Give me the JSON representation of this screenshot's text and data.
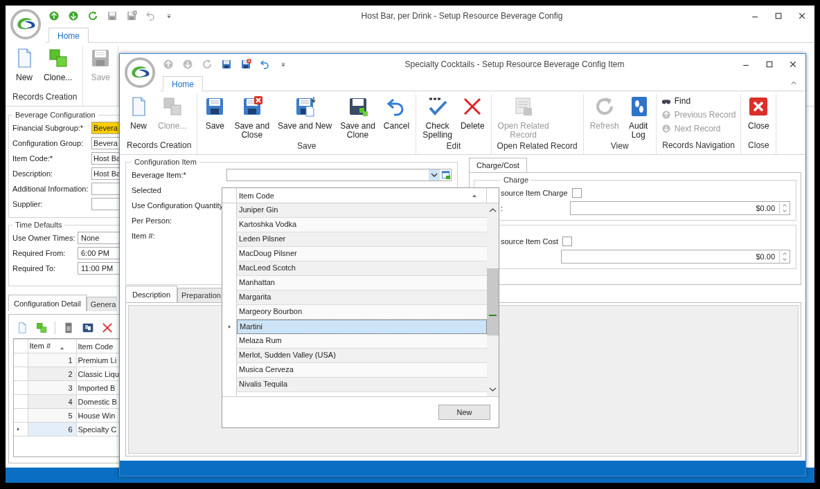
{
  "outer_window": {
    "quick_access": [
      {
        "disabled": false
      },
      {
        "disabled": false
      },
      {
        "disabled": false
      },
      {
        "disabled": true
      },
      {
        "disabled": true
      },
      {
        "disabled": true
      }
    ],
    "title": "Host Bar, per Drink - Setup Resource Beverage Config",
    "tabs": [
      {
        "label": "Home",
        "selected": true
      }
    ],
    "ribbon": {
      "groups": [
        {
          "label": "Records Creation",
          "kind": "large",
          "buttons": [
            {
              "label": "New",
              "disabled": false
            },
            {
              "label": "Clone...",
              "disabled": false
            }
          ]
        },
        {
          "kind": "large",
          "buttons": [
            {
              "label": "Save",
              "disabled": true
            }
          ]
        }
      ]
    },
    "beverage_configuration": {
      "title": "Beverage Configuration",
      "fields": [
        {
          "label": "Financial Subgroup:*",
          "value": "Bevera",
          "highlighted": true
        },
        {
          "label": "Configuration Group:",
          "value": "Bevera",
          "highlighted": false
        },
        {
          "label": "Item Code:*",
          "value": "Host Ba",
          "highlighted": false
        },
        {
          "label": "Description:",
          "value": "Host Ba",
          "highlighted": false
        },
        {
          "label": "Additional Information:",
          "highlighted": false
        },
        {
          "label": "Supplier:",
          "highlighted": false
        }
      ]
    },
    "time_defaults": {
      "title": "Time Defaults",
      "fields": [
        {
          "label": "Use Owner Times:",
          "value": "None"
        },
        {
          "label": "Required From:",
          "value": "6:00 PM"
        },
        {
          "label": "Required To:",
          "value": "11:00 PM"
        }
      ]
    },
    "detail_tabs": [
      {
        "label": "Configuration Detail",
        "selected": true
      },
      {
        "label": "Genera",
        "selected": false
      }
    ],
    "grid": {
      "columns": [
        {
          "label": "Item #",
          "sorted": true
        },
        {
          "label": "Item Code",
          "sorted": false
        }
      ],
      "rows": [
        {
          "item_no": "1",
          "item_code": "Premium Li",
          "selected": false
        },
        {
          "item_no": "2",
          "item_code": "Classic Liqu",
          "selected": false
        },
        {
          "item_no": "3",
          "item_code": "Imported B",
          "selected": false
        },
        {
          "item_no": "4",
          "item_code": "Domestic B",
          "selected": false
        },
        {
          "item_no": "5",
          "item_code": "House Win",
          "selected": false
        },
        {
          "item_no": "6",
          "item_code": "Specialty C",
          "selected": true
        }
      ]
    }
  },
  "inner_window": {
    "quick_access": [
      {
        "disabled": true
      },
      {
        "disabled": true
      },
      {
        "disabled": true
      },
      {
        "disabled": false
      },
      {
        "disabled": false
      },
      {
        "disabled": false
      }
    ],
    "title": "Specialty Cocktails - Setup Resource Beverage Config Item",
    "tabs": [
      {
        "label": "Home",
        "selected": true
      }
    ],
    "ribbon": {
      "groups": [
        {
          "label": "Records Creation",
          "kind": "large",
          "buttons": [
            {
              "label": "New",
              "disabled": false
            },
            {
              "label": "Clone...",
              "disabled": true
            }
          ]
        },
        {
          "label": "Save",
          "kind": "large",
          "buttons": [
            {
              "label": "Save",
              "disabled": false
            },
            {
              "label": "Save and\nClose",
              "disabled": false
            },
            {
              "label": "Save and New",
              "disabled": false
            },
            {
              "label": "Save and\nClone",
              "disabled": false
            },
            {
              "label": "Cancel",
              "disabled": false
            }
          ]
        },
        {
          "label": "Edit",
          "kind": "large",
          "buttons": [
            {
              "label": "Check\nSpelling",
              "disabled": false
            },
            {
              "label": "Delete",
              "disabled": false
            }
          ]
        },
        {
          "label": "Open Related Record",
          "kind": "large",
          "buttons": [
            {
              "label": "Open Related\nRecord",
              "disabled": true
            }
          ]
        },
        {
          "label": "View",
          "kind": "large",
          "buttons": [
            {
              "label": "Refresh",
              "disabled": true
            },
            {
              "label": "Audit\nLog",
              "disabled": false
            }
          ]
        },
        {
          "label": "Records Navigation",
          "kind": "small",
          "buttons": [
            {
              "label": "Find",
              "disabled": false
            },
            {
              "label": "Previous Record",
              "disabled": true
            },
            {
              "label": "Next Record",
              "disabled": true
            }
          ]
        },
        {
          "label": "Close",
          "kind": "large",
          "buttons": [
            {
              "label": "Close",
              "disabled": false
            }
          ]
        }
      ]
    },
    "configuration_item": {
      "title": "Configuration Item",
      "fields": [
        {
          "label": "Beverage Item:*",
          "kind": "combo"
        },
        {
          "label": "Selected",
          "kind": "label"
        },
        {
          "label": "Use Configuration Quantity",
          "kind": "label"
        },
        {
          "label": "Per Person:",
          "kind": "label"
        },
        {
          "label": "Item #:",
          "kind": "label"
        }
      ]
    },
    "charge_cost": {
      "tabs": [
        {
          "label": "Charge/Cost",
          "selected": true
        }
      ],
      "charge": {
        "title": "Charge",
        "checkbox_label": "source Item Charge",
        "checked": false,
        "amount_label": ":",
        "amount": "$0.00"
      },
      "cost": {
        "checkbox_label": "source Item Cost",
        "checked": false,
        "amount": "$0.00"
      }
    },
    "bottom_tabs": [
      {
        "label": "Description",
        "selected": true
      },
      {
        "label": "Preparation",
        "selected": false
      }
    ],
    "dropdown": {
      "columns": [
        {
          "label": "Item Code",
          "sorted": true
        }
      ],
      "rows": [
        {
          "label": "Juniper Gin",
          "selected": false
        },
        {
          "label": "Kartoshka Vodka",
          "selected": false
        },
        {
          "label": "Leden Pilsner",
          "selected": false
        },
        {
          "label": "MacDoug Pilsner",
          "selected": false
        },
        {
          "label": "MacLeod Scotch",
          "selected": false
        },
        {
          "label": "Manhattan",
          "selected": false
        },
        {
          "label": "Margarita",
          "selected": false
        },
        {
          "label": "Margeory Bourbon",
          "selected": false
        },
        {
          "label": "Martini",
          "selected": true
        },
        {
          "label": "Melaza Rum",
          "selected": false
        },
        {
          "label": "Merlot, Sudden Valley (USA)",
          "selected": false
        },
        {
          "label": "Musica Cerveza",
          "selected": false
        },
        {
          "label": "Nivalis Tequila",
          "selected": false
        }
      ],
      "button": "New"
    }
  }
}
